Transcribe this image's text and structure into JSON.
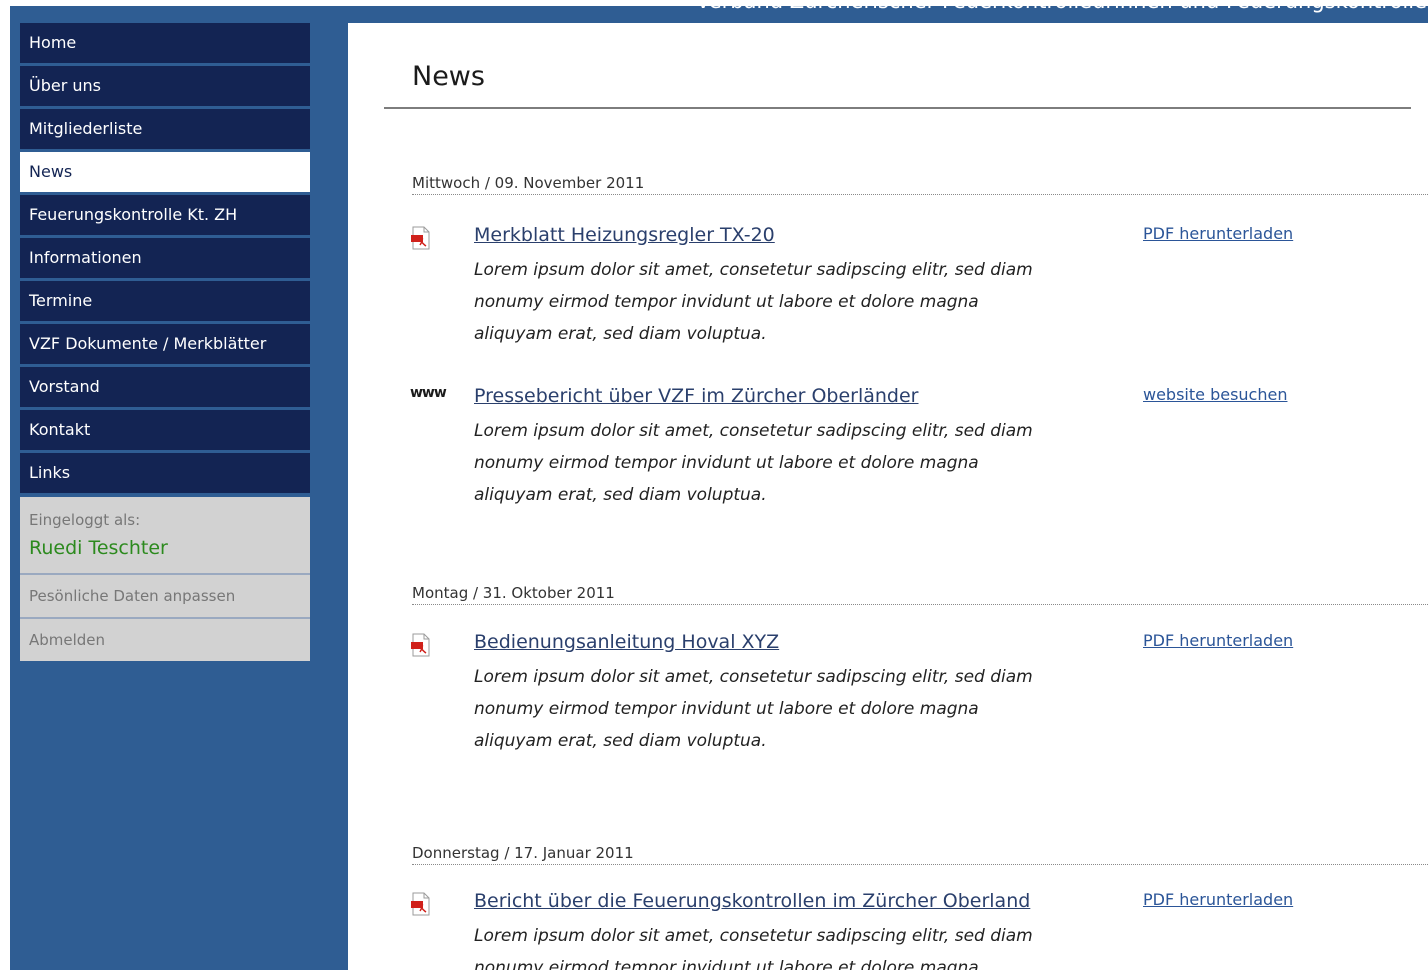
{
  "header": {
    "site_title": "Verband Zürcherischer Feuerkontrolleurinnen und Feuerungskontrolleure"
  },
  "sidebar": {
    "items": [
      {
        "label": "Home"
      },
      {
        "label": "Über uns"
      },
      {
        "label": "Mitgliederliste"
      },
      {
        "label": "News"
      },
      {
        "label": "Feuerungskontrolle Kt. ZH"
      },
      {
        "label": "Informationen"
      },
      {
        "label": "Termine"
      },
      {
        "label": "VZF Dokumente / Merkblätter"
      },
      {
        "label": "Vorstand"
      },
      {
        "label": "Kontakt"
      },
      {
        "label": "Links"
      }
    ],
    "active": "News",
    "login": {
      "label": "Eingeloggt als:",
      "name": "Ruedi Teschter",
      "edit_link": "Pesönliche Daten anpassen",
      "logout_link": "Abmelden"
    }
  },
  "main": {
    "title": "News",
    "groups": [
      {
        "date": "Mittwoch  / 09. November 2011",
        "entries": [
          {
            "icon": "pdf-icon",
            "title": "Merkblatt Heizungsregler TX-20",
            "text": "Lorem ipsum dolor sit amet, consetetur sadipscing elitr, sed diam nonumy eirmod tempor invidunt ut labore et dolore magna aliquyam erat, sed diam voluptua.",
            "action": "PDF herunterladen"
          },
          {
            "icon": "www-icon",
            "icon_text": "www",
            "title": "Pressebericht über VZF im Zürcher Oberländer",
            "text": "Lorem ipsum dolor sit amet, consetetur sadipscing elitr, sed diam nonumy eirmod tempor invidunt ut labore et dolore magna aliquyam erat, sed diam voluptua.",
            "action": "website besuchen"
          }
        ]
      },
      {
        "date": "Montag  / 31. Oktober 2011",
        "entries": [
          {
            "icon": "pdf-icon",
            "title": "Bedienungsanleitung Hoval XYZ",
            "text": "Lorem ipsum dolor sit amet, consetetur sadipscing elitr, sed diam nonumy eirmod tempor invidunt ut labore et dolore magna aliquyam erat, sed diam voluptua.",
            "action": "PDF herunterladen"
          }
        ]
      },
      {
        "date": "Donnerstag / 17. Januar 2011",
        "entries": [
          {
            "icon": "pdf-icon",
            "title": "Bericht über die Feuerungskontrollen im Zürcher Oberland",
            "text": "Lorem ipsum dolor sit amet, consetetur sadipscing elitr, sed diam nonumy eirmod tempor invidunt ut labore et dolore magna aliquyam erat, sed diam voluptua.",
            "action": "PDF herunterladen"
          }
        ]
      }
    ]
  },
  "colors": {
    "page_blue": "#2f5d93",
    "nav_dark": "#132453",
    "login_name_green": "#2c8a1e",
    "link_blue": "#2b5598"
  }
}
